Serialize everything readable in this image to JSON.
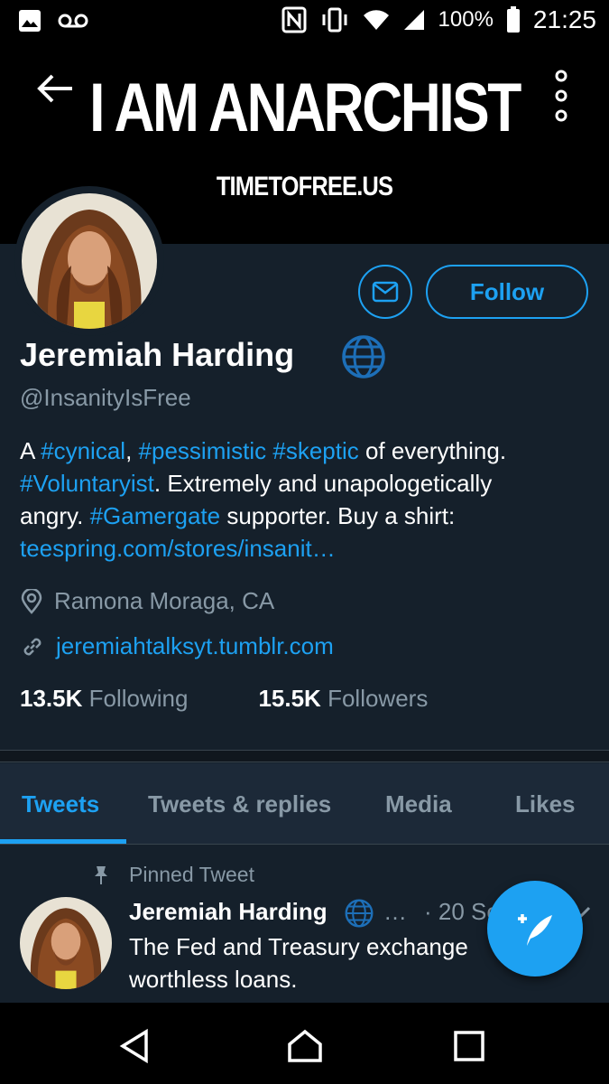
{
  "status_bar": {
    "battery_text": "100%",
    "time": "21:25",
    "icons": [
      "image-icon",
      "voicemail-icon",
      "nfc-icon",
      "vibrate-icon",
      "wifi-icon",
      "signal-icon",
      "battery-icon"
    ]
  },
  "banner": {
    "title": "I AM ANARCHIST",
    "subtitle": "TIMETOFREE.US"
  },
  "header": {
    "back_icon": "back-arrow-icon",
    "more_icon": "more-vertical-icon"
  },
  "profile": {
    "name": "Jeremiah Harding",
    "handle": "@InsanityIsFree",
    "bio": {
      "line1": [
        {
          "t": "A ",
          "link": false
        },
        {
          "t": "#cynical",
          "link": true
        },
        {
          "t": ", ",
          "link": false
        },
        {
          "t": "#pessimistic",
          "link": true
        },
        {
          "t": " ",
          "link": false
        },
        {
          "t": "#skeptic",
          "link": true
        },
        {
          "t": " of everything.",
          "link": false
        }
      ],
      "line2": [
        {
          "t": "#Voluntaryist",
          "link": true
        },
        {
          "t": ". Extremely and unapologetically",
          "link": false
        }
      ],
      "line3": [
        {
          "t": "angry. ",
          "link": false
        },
        {
          "t": "#Gamergate",
          "link": true
        },
        {
          "t": " supporter. Buy a shirt:",
          "link": false
        }
      ],
      "line4": [
        {
          "t": "teespring.com/stores/insanit…",
          "link": true
        }
      ]
    },
    "location": "Ramona Moraga, CA",
    "website": "jeremiahtalksyt.tumblr.com",
    "following_count": "13.5K",
    "following_label": "Following",
    "followers_count": "15.5K",
    "followers_label": "Followers",
    "follow_button": "Follow"
  },
  "tabs": [
    {
      "label": "Tweets",
      "active": true
    },
    {
      "label": "Tweets & replies",
      "active": false
    },
    {
      "label": "Media",
      "active": false
    },
    {
      "label": "Likes",
      "active": false
    }
  ],
  "pinned_tweet": {
    "pinned_label": "Pinned Tweet",
    "author": "Jeremiah Harding",
    "ellipsis": "…",
    "date": "· 20 Sep",
    "text_line1": "The Fed and Treasury exchange",
    "text_line2": "worthless loans."
  },
  "colors": {
    "accent": "#1da1f2",
    "background": "#15202b",
    "secondary_text": "#8899a6"
  }
}
